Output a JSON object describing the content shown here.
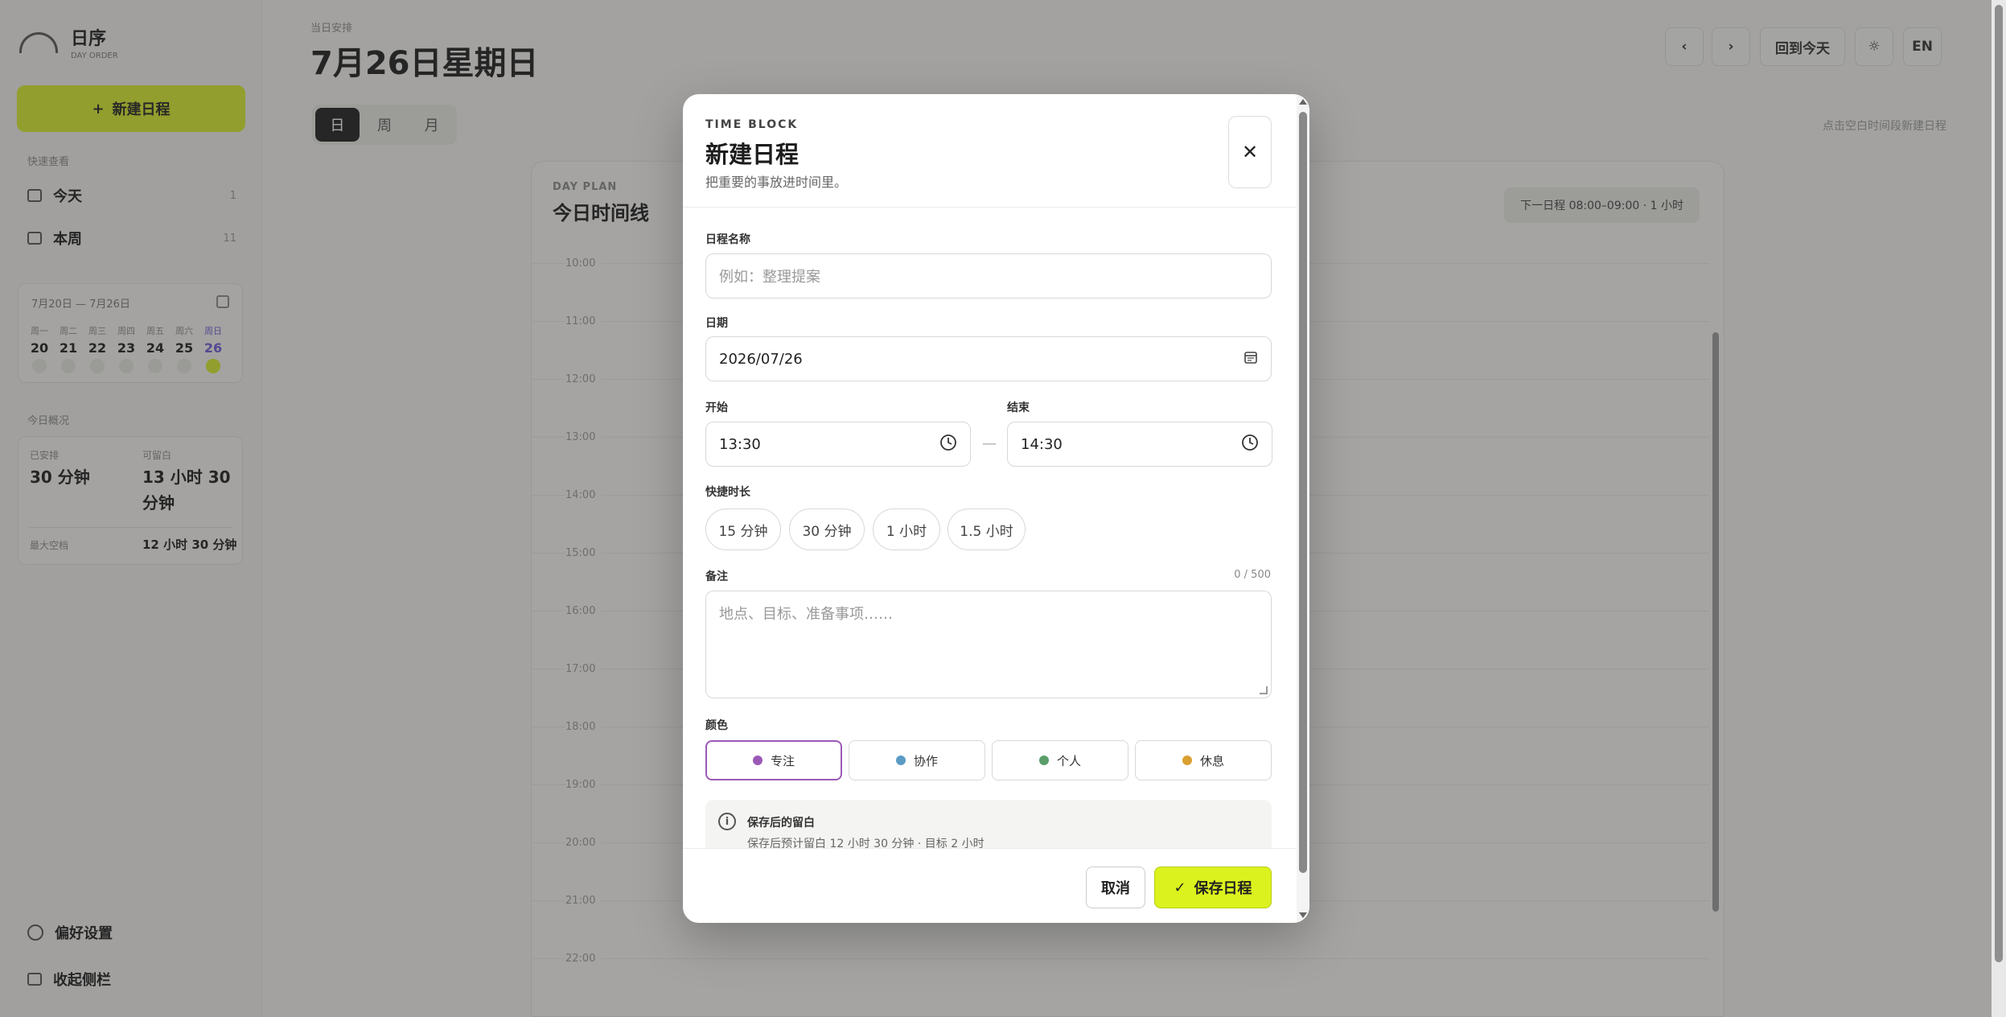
{
  "app": {
    "brand_name": "日序",
    "brand_sub": "DAY ORDER",
    "new_event_label": "新建日程",
    "quick_section": "快速查看",
    "nav": [
      {
        "label": "今天",
        "count": "1"
      },
      {
        "label": "本周",
        "count": "11"
      }
    ],
    "mini_cal": {
      "range": "7月20日 — 7月26日",
      "days": [
        {
          "name": "周一",
          "num": "20"
        },
        {
          "name": "周二",
          "num": "21"
        },
        {
          "name": "周三",
          "num": "22"
        },
        {
          "name": "周四",
          "num": "23"
        },
        {
          "name": "周五",
          "num": "24"
        },
        {
          "name": "周六",
          "num": "25"
        },
        {
          "name": "周日",
          "num": "26"
        }
      ]
    },
    "stats_section": "今日概况",
    "stats": {
      "scheduled_label": "已安排",
      "scheduled_value": "30 分钟",
      "free_label": "可留白",
      "free_value": "13 小时 30 分钟",
      "max_label": "最大空档",
      "max_value": "12 小时 30 分钟"
    },
    "footer": {
      "prefs": "偏好设置",
      "collapse": "收起侧栏"
    }
  },
  "main": {
    "subtitle": "当日安排",
    "title": "7月26日星期日",
    "views": [
      "日",
      "周",
      "月"
    ],
    "today_btn": "回到今天",
    "lang_btn": "EN",
    "hint": "点击空白时间段新建日程",
    "day_plan_sub": "DAY PLAN",
    "day_plan_title": "今日时间线",
    "next_badge": "下一日程 08:00–09:00 · 1 小时",
    "hours": [
      "10:00",
      "11:00",
      "12:00",
      "13:00",
      "14:00",
      "15:00",
      "16:00",
      "17:00",
      "18:00",
      "19:00",
      "20:00",
      "21:00",
      "22:00"
    ]
  },
  "modal": {
    "eyebrow": "TIME BLOCK",
    "title": "新建日程",
    "desc": "把重要的事放进时间里。",
    "name_label": "日程名称",
    "name_placeholder": "例如：整理提案",
    "date_label": "日期",
    "date_value": "2026/07/26",
    "start_label": "开始",
    "start_value": "13:30",
    "end_label": "结束",
    "end_value": "14:30",
    "dash": "—",
    "quick_label": "快捷时长",
    "quick": [
      "15 分钟",
      "30 分钟",
      "1 小时",
      "1.5 小时"
    ],
    "notes_label": "备注",
    "notes_counter": "0 / 500",
    "notes_placeholder": "地点、目标、准备事项……",
    "color_label": "颜色",
    "colors": [
      {
        "label": "专注",
        "hex": "#9b59b6"
      },
      {
        "label": "协作",
        "hex": "#5b9bc4"
      },
      {
        "label": "个人",
        "hex": "#5a9e6a"
      },
      {
        "label": "休息",
        "hex": "#d9a030"
      }
    ],
    "info_title": "保存后的留白",
    "info_desc": "保存后预计留白 12 小时 30 分钟 · 目标 2 小时",
    "cancel": "取消",
    "save": "保存日程"
  }
}
